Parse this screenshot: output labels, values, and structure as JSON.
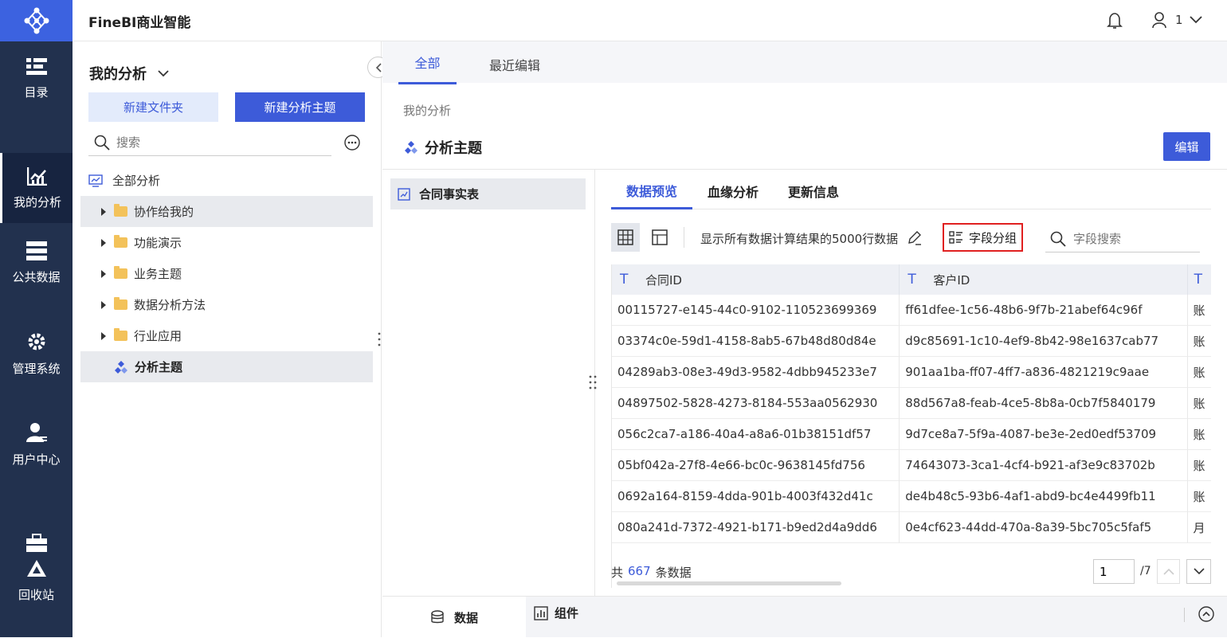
{
  "app": {
    "title": "FineBI商业智能"
  },
  "header": {
    "user": "1"
  },
  "nav": {
    "items": [
      {
        "label": "目录",
        "icon": "catalog-icon"
      },
      {
        "label": "我的分析",
        "icon": "analysis-icon"
      },
      {
        "label": "公共数据",
        "icon": "public-data-icon"
      },
      {
        "label": "管理系统",
        "icon": "gear-icon"
      },
      {
        "label": "用户中心",
        "icon": "user-icon"
      },
      {
        "label": "回收站",
        "icon": "recycle-icon"
      }
    ]
  },
  "left_panel": {
    "title": "我的分析",
    "new_folder": "新建文件夹",
    "new_subject": "新建分析主题",
    "search_placeholder": "搜索",
    "tree": [
      {
        "label": "全部分析"
      },
      {
        "label": "协作给我的"
      },
      {
        "label": "功能演示"
      },
      {
        "label": "业务主题"
      },
      {
        "label": "数据分析方法"
      },
      {
        "label": "行业应用"
      },
      {
        "label": "分析主题"
      }
    ]
  },
  "main": {
    "tabs": [
      "全部",
      "最近编辑"
    ],
    "breadcrumb": "我的分析",
    "subject_title": "分析主题",
    "edit_label": "编辑",
    "table_item": "合同事实表",
    "sub_tabs": [
      "数据预览",
      "血缘分析",
      "更新信息"
    ],
    "row_info": "显示所有数据计算结果的5000行数据",
    "field_group": "字段分组",
    "field_search_placeholder": "字段搜索",
    "type_icon": "T",
    "columns": [
      "合同ID",
      "客户ID"
    ],
    "rows": [
      [
        "00115727-e145-44c0-9102-110523699369",
        "ff61dfee-1c56-48b6-9f7b-21abef64c96f",
        "账"
      ],
      [
        "03374c0e-59d1-4158-8ab5-67b48d80d84e",
        "d9c85691-1c10-4ef9-8b42-98e1637cab77",
        "账"
      ],
      [
        "04289ab3-08e3-49d3-9582-4dbb945233e7",
        "901aa1ba-ff07-4ff7-a836-4821219c9aae",
        "账"
      ],
      [
        "04897502-5828-4273-8184-553aa0562930",
        "88d567a8-feab-4ce5-8b8a-0cb7f5840179",
        "账"
      ],
      [
        "056c2ca7-a186-40a4-a8a6-01b38151df57",
        "9d7ce8a7-5f9a-4087-be3e-2ed0edf53709",
        "账"
      ],
      [
        "05bf042a-27f8-4e66-bc0c-9638145fd756",
        "74643073-3ca1-4cf4-b921-af3e9c83702b",
        "账"
      ],
      [
        "0692a164-8159-4dda-901b-4003f432d41c",
        "de4b48c5-93b6-4af1-abd9-bc4e4499fb11",
        "账"
      ],
      [
        "080a241d-7372-4921-b171-b9ed2d4a9dd6",
        "0e4cf623-44dd-470a-8a39-5bc705c5faf5",
        "月"
      ]
    ],
    "total_prefix": "共",
    "total_count": "667",
    "total_suffix": "条数据",
    "page_current": "1",
    "page_total": "/7",
    "bottom_tabs": [
      "数据",
      "组件"
    ]
  },
  "colors": {
    "accent": "#3d5bd9",
    "nav_bg": "#22314e",
    "logo_bg": "#3c62e0",
    "highlight_border": "#e02020"
  }
}
